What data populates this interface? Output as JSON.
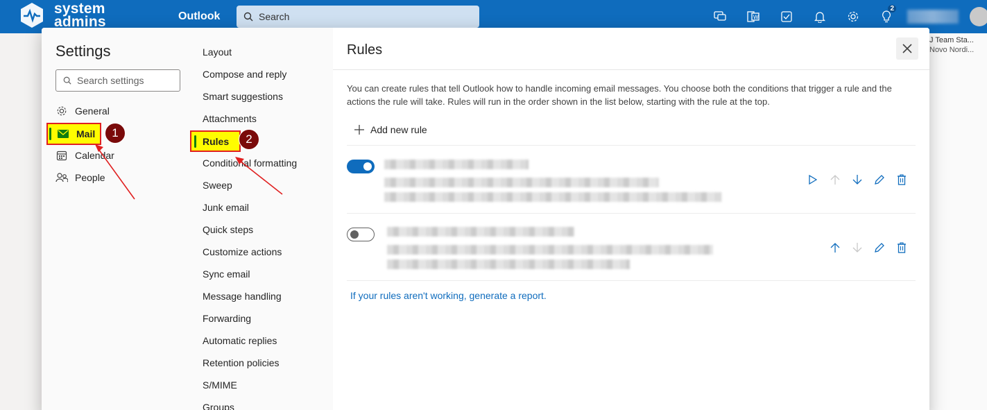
{
  "topbar": {
    "brand_line1": "system",
    "brand_line2": "admins",
    "app_name": "Outlook",
    "search_placeholder": "Search",
    "notification_count": "2",
    "accent_color": "#0f6cbd"
  },
  "background": {
    "right_line1": "J Team Sta...",
    "right_line2": "Novo Nordi..."
  },
  "settings": {
    "title": "Settings",
    "search_placeholder": "Search settings",
    "categories": [
      {
        "label": "General",
        "icon": "gear-icon"
      },
      {
        "label": "Mail",
        "icon": "mail-icon",
        "selected": true
      },
      {
        "label": "Calendar",
        "icon": "calendar-icon"
      },
      {
        "label": "People",
        "icon": "people-icon"
      }
    ],
    "mail_subsections": [
      "Layout",
      "Compose and reply",
      "Smart suggestions",
      "Attachments",
      "Rules",
      "Conditional formatting",
      "Sweep",
      "Junk email",
      "Quick steps",
      "Customize actions",
      "Sync email",
      "Message handling",
      "Forwarding",
      "Automatic replies",
      "Retention policies",
      "S/MIME",
      "Groups"
    ]
  },
  "annotations": {
    "marker1": "1",
    "marker2": "2",
    "highlight_color": "#fffc00",
    "outline_color": "#e02020"
  },
  "rules_pane": {
    "title": "Rules",
    "description": "You can create rules that tell Outlook how to handle incoming email messages. You choose both the conditions that trigger a rule and the actions the rule will take. Rules will run in the order shown in the list below, starting with the rule at the top.",
    "add_rule_label": "Add new rule",
    "rules": [
      {
        "enabled": true,
        "name_redacted": true
      },
      {
        "enabled": false,
        "name_redacted": true
      }
    ],
    "report_link": "If your rules aren't working, generate a report."
  }
}
